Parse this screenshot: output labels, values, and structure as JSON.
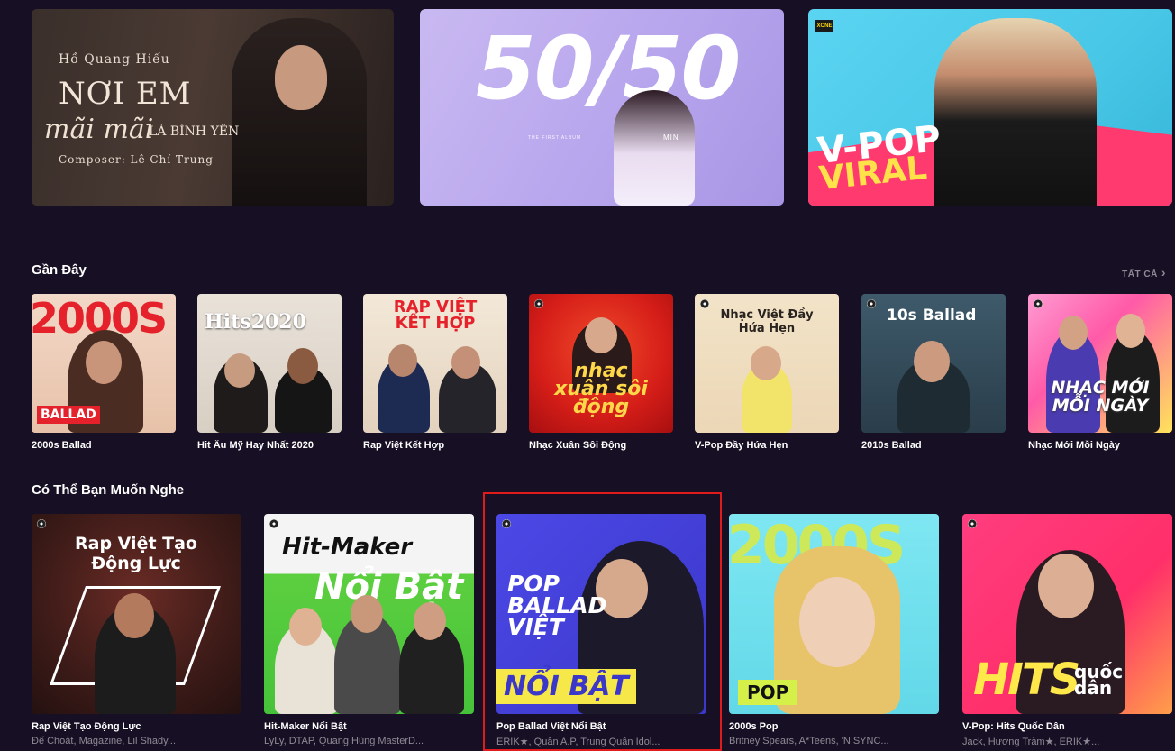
{
  "banners": [
    {
      "artist": "Hồ Quang Hiếu",
      "title": "NƠI EM",
      "script": "mãi mãi",
      "subtitle": "LÀ BÌNH YÊN",
      "composer": "Composer: Lê Chí Trung"
    },
    {
      "title": "50/50",
      "subtitle": "THE FIRST ALBUM",
      "artist": "MIN"
    },
    {
      "badge": "XONE",
      "title_line1": "V-POP",
      "title_line2": "VIRAL"
    }
  ],
  "recent": {
    "title": "Gần Đây",
    "see_all": "TẤT CẢ",
    "items": [
      {
        "label": "2000s Ballad",
        "art_text": "2000S",
        "art_badge": "BALLAD"
      },
      {
        "label": "Hit Âu Mỹ Hay Nhất 2020",
        "art_text": "Hits2020"
      },
      {
        "label": "Rap Việt Kết Hợp",
        "art_text": "RAP VIỆT KẾT HỢP"
      },
      {
        "label": "Nhạc Xuân Sôi Động",
        "art_text": "nhạc xuân sôi động"
      },
      {
        "label": "V-Pop Đầy Hứa Hẹn",
        "art_text": "Nhạc Việt Đầy Hứa Hẹn"
      },
      {
        "label": "2010s Ballad",
        "art_text": "10s Ballad"
      },
      {
        "label": "Nhạc Mới Mỗi Ngày",
        "art_text": "NHẠC MỚI MỖI NGÀY"
      }
    ]
  },
  "suggest": {
    "title": "Có Thể Bạn Muốn Nghe",
    "items": [
      {
        "label": "Rap Việt Tạo Động Lực",
        "artists": "Đế Choắt, Magazine, Lil Shady...",
        "art_text": "Rap Việt Tạo Động Lực"
      },
      {
        "label": "Hit-Maker Nổi Bật",
        "artists": "LyLy, DTAP, Quang Hùng MasterD...",
        "art_line1": "Hit-Maker",
        "art_line2": "Nổi Bật"
      },
      {
        "label": "Pop Ballad Việt Nổi Bật",
        "artists": "ERIK★, Quân A.P, Trung Quân Idol...",
        "art_line1": "POP BALLAD VIỆT",
        "art_line2": "NỔI BẬT"
      },
      {
        "label": "2000s Pop",
        "artists": "Britney Spears, A*Teens, 'N SYNC...",
        "art_text": "2000S",
        "art_badge": "POP"
      },
      {
        "label": "V-Pop: Hits Quốc Dân",
        "artists": "Jack, Hương Tràm★, ERIK★...",
        "art_line1": "HITS",
        "art_line2": "quốc dân"
      }
    ]
  },
  "colors": {
    "background": "#170f23",
    "highlight": "#e11b1b",
    "muted_text": "#8e8a96"
  }
}
